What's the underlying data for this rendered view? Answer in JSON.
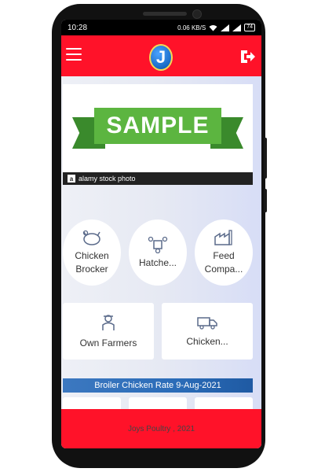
{
  "status": {
    "time": "10:28",
    "data_speed": "0.06 KB/S",
    "battery": "74"
  },
  "header": {
    "logo_letter": "J",
    "menu_icon": "hamburger-icon",
    "logout_icon": "logout-icon"
  },
  "banner": {
    "ribbon_text": "SAMPLE",
    "watermark": "alamy stock photo",
    "watermark_logo": "a"
  },
  "categories": [
    {
      "label": "Chicken Brocker",
      "icon": "chicken-icon"
    },
    {
      "label": "Hatche...",
      "icon": "hatchery-icon"
    },
    {
      "label": "Feed Compa...",
      "icon": "factory-icon"
    }
  ],
  "cards": [
    {
      "label": "Own Farmers",
      "icon": "farmer-icon"
    },
    {
      "label": "Chicken...",
      "icon": "truck-icon"
    }
  ],
  "rate_title": "Broiler Chicken Rate 9-Aug-2021",
  "footer": {
    "text": "Joys Poultry , 2021"
  },
  "colors": {
    "primary_red": "#ff1229",
    "rate_bar_blue": "#2b6cb8",
    "ribbon_green": "#5cb540"
  }
}
